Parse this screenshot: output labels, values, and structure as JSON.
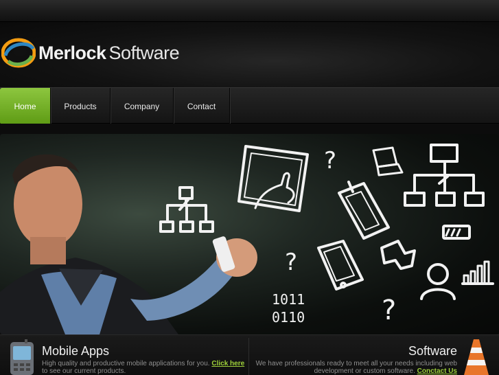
{
  "brand": {
    "name_bold": "Merlock",
    "name_light": "Software"
  },
  "nav": {
    "items": [
      {
        "label": "Home",
        "active": true
      },
      {
        "label": "Products",
        "active": false
      },
      {
        "label": "Company",
        "active": false
      },
      {
        "label": "Contact",
        "active": false
      }
    ]
  },
  "hero": {
    "binary_line1": "1011",
    "binary_line2": "0110"
  },
  "panels": {
    "mobile": {
      "title": "Mobile Apps",
      "text_before": "High quality and productive mobile applications for you. ",
      "link": "Click here",
      "text_after": "to see our current products."
    },
    "software": {
      "title": "Software",
      "text_before": "We have professionals ready to meet all your needs including web",
      "text_line2": "development or custom software. ",
      "link": "Conctact Us"
    }
  },
  "colors": {
    "accent": "#8dc63f",
    "link": "#9fd13a",
    "background": "#0d0d0d"
  },
  "icons": [
    "logo-swirl-icon",
    "phone-icon",
    "traffic-cone-icon"
  ]
}
